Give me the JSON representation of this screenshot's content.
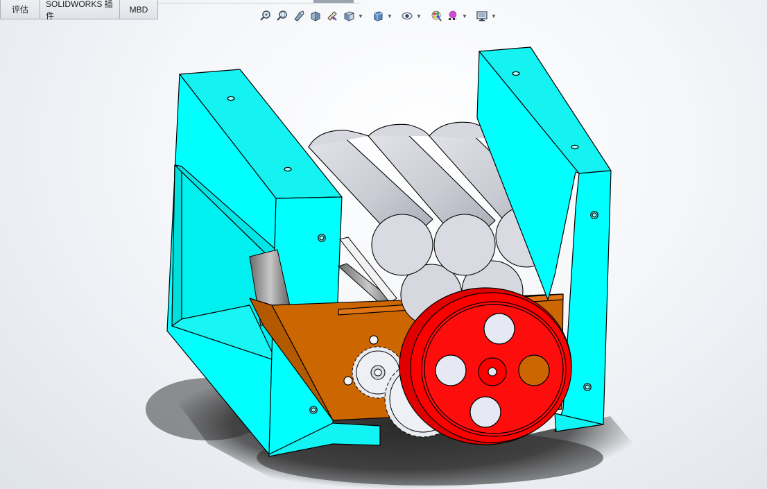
{
  "tabs": [
    {
      "label": "评估"
    },
    {
      "label": "SOLIDWORKS 插件"
    },
    {
      "label": "MBD"
    }
  ],
  "toolbar": {
    "icons": [
      "zoom-to-fit-icon",
      "zoom-to-area-icon",
      "previous-view-icon",
      "section-view-icon",
      "dynamic-annotation-views-icon",
      "view-orientation-icon",
      "display-style-icon",
      "hide-show-items-icon",
      "edit-appearance-icon",
      "apply-scene-icon",
      "view-settings-icon"
    ]
  },
  "colors": {
    "frame": "#00ffff",
    "plate": "#cc6600",
    "wheel": "#ff0000",
    "roller": "#d2d4dc",
    "gear": "#eef0f6"
  }
}
